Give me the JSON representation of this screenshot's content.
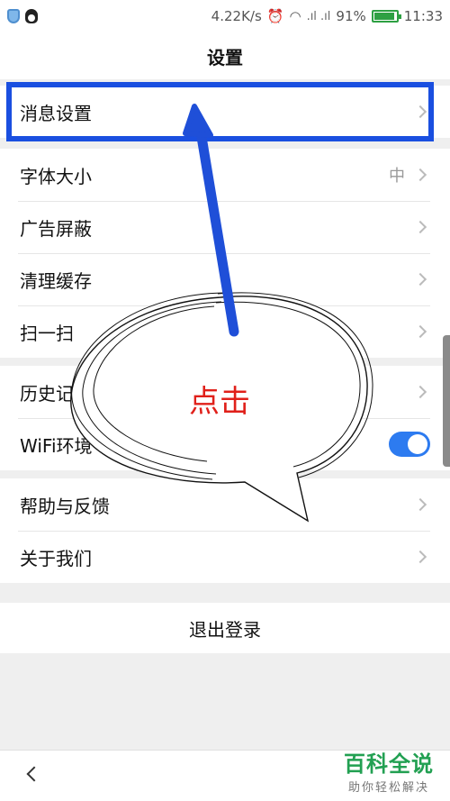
{
  "status_bar": {
    "net_speed": "4.22K/s",
    "signal": ".ıl .ıl",
    "battery_pct": "91%",
    "battery_level": 0.91,
    "time": "11:33"
  },
  "header": {
    "title": "设置"
  },
  "groups": [
    {
      "items": [
        {
          "label": "消息设置"
        }
      ]
    },
    {
      "items": [
        {
          "label": "字体大小",
          "value": "中"
        },
        {
          "label": "广告屏蔽"
        },
        {
          "label": "清理缓存"
        },
        {
          "label": "扫一扫"
        }
      ]
    },
    {
      "items": [
        {
          "label": "历史记"
        },
        {
          "label": "WiFi环境",
          "toggle_on": true
        }
      ]
    },
    {
      "items": [
        {
          "label": "帮助与反馈"
        },
        {
          "label": "关于我们"
        }
      ]
    }
  ],
  "logout": {
    "label": "退出登录"
  },
  "annotation": {
    "callout_text": "点击",
    "highlight_color": "#1a4fe0",
    "text_color": "#e0201a"
  },
  "watermark": {
    "title": "百科全说",
    "subtitle": "助你轻松解决"
  }
}
